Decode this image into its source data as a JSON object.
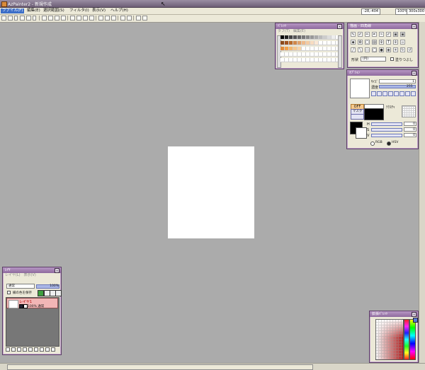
{
  "window": {
    "title": "AzPainter2 - 新規作成"
  },
  "menu": {
    "items": [
      "ファイル(F)",
      "編集(E)",
      "選択範囲(S)",
      "フィルタ(I)",
      "表示(V)",
      "ヘルプ(H)"
    ],
    "active_index": 0,
    "coords": "-28,-404",
    "zoom": "100%",
    "size": "300x300"
  },
  "palette_panel": {
    "title": "ﾊﾟﾚｯﾄ",
    "tabs": "タブ(T)　編集(E)"
  },
  "toolbox_panel": {
    "title": "描画 - 四角線",
    "shape_label": "形状",
    "shape_value": "(円)",
    "fill_label": "塗りつぶし"
  },
  "option_panel": {
    "title": "ｵﾌﾟｼｮﾝ",
    "size_label": "ｻｲｽﾞ",
    "size_value": "1",
    "density_label": "濃度",
    "density_value": "255",
    "off_label": "OFF",
    "mask_label": "マスク",
    "texture_label": "ﾃｸｽﾁｬ",
    "h_label": "H",
    "h_value": "0",
    "s_label": "S",
    "s_value": "0",
    "v_label": "V",
    "v_value": "0",
    "rgb_label": "RGB",
    "hsv_label": "HSV",
    "colors": {
      "foreground": "#000000",
      "background": "#ffffff"
    }
  },
  "layer_panel": {
    "title": "ﾚｲﾔ",
    "tabs": "レイヤ(L)　表示(V)",
    "blend_mode": "通常",
    "opacity": "100%",
    "lock_label": "縁の色を保存",
    "layer_name": "レイヤ1",
    "layer_info": "100% 通常"
  },
  "ext_palette_panel": {
    "title": "拡張ﾊﾟﾚｯﾄ"
  },
  "canvas": {
    "background": "#ffffff",
    "workspace": "#ababab"
  }
}
